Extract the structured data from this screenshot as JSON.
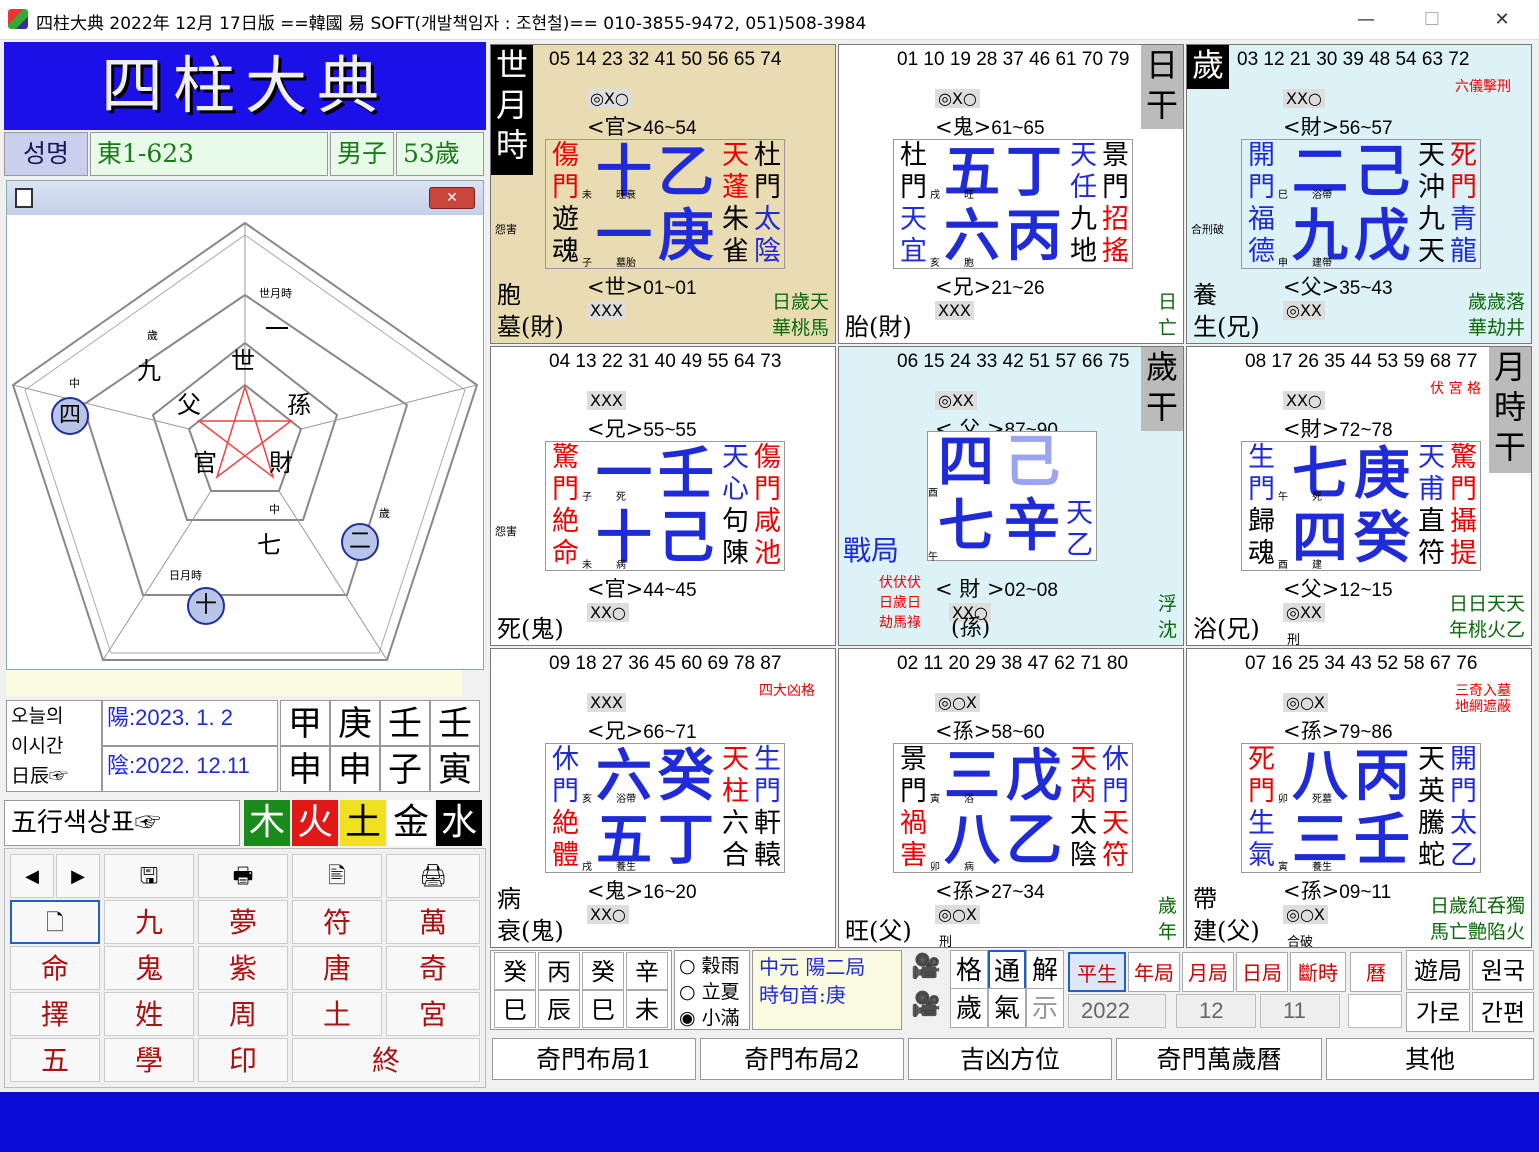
{
  "titlebar": {
    "title": "四柱大典 2022年 12月 17日版 ==韓國 易 SOFT(개발책임자 : 조현철)== 010-3855-9472, 051)508-3984",
    "min": "—",
    "max": "☐",
    "close": "✕"
  },
  "logo": "四柱大典",
  "name_row": {
    "label": "성명",
    "value": "東1-623",
    "gender": "男子",
    "age": "53歲"
  },
  "pentagon": {
    "close": "✕",
    "inner": [
      "世",
      "孫",
      "財",
      "官",
      "父"
    ],
    "outer": [
      {
        "sub": "世月時",
        "main": "一"
      },
      {
        "sub": "歲",
        "main": "九"
      },
      {
        "sub": "中",
        "main": "四"
      },
      {
        "sub": "中",
        "main": "七"
      },
      {
        "sub": "歲",
        "main": "二"
      },
      {
        "sub": "日月時",
        "main": "十"
      }
    ]
  },
  "today": {
    "label1": "오늘의",
    "label2": "이시간",
    "label3": "日辰☞",
    "solar": "陽:2023.  1. 2",
    "lunar": "陰:2022.  12.11",
    "stems": [
      "甲",
      "庚",
      "壬",
      "壬"
    ],
    "branches": [
      "申",
      "申",
      "子",
      "寅"
    ]
  },
  "elements": {
    "label": "五行색상표☞",
    "items": [
      "木",
      "火",
      "土",
      "金",
      "水"
    ],
    "colors": [
      "#1a8a1a",
      "#e01818",
      "#f0e020",
      "#ffffff",
      "#000000"
    ]
  },
  "toolbar": {
    "row1": [
      "◀",
      "▶",
      "🖫",
      "🖶",
      "🖹",
      "🖨"
    ],
    "row2": [
      "🗋",
      "九",
      "夢",
      "符",
      "萬"
    ],
    "row3": [
      "命",
      "鬼",
      "紫",
      "唐",
      "奇"
    ],
    "row4": [
      "擇",
      "姓",
      "周",
      "土",
      "宮"
    ],
    "row5": [
      "五",
      "學",
      "印",
      "終"
    ]
  },
  "cells": [
    {
      "nums": "05 14 23 32 41 50 56 65 74",
      "side": [
        "世",
        "月",
        "時"
      ],
      "marks": "◎X○",
      "rel_top": "<官>",
      "rel_top_r": "46~54",
      "left_note": "怨害",
      "big1": "十",
      "big2": "乙",
      "big3": "一",
      "big4": "庚",
      "l1": "傷門",
      "l1c": "red",
      "l2": "遊魂",
      "l2c": "black",
      "sm1": "未",
      "sm2": "旺衰",
      "sm3": "子",
      "sm4": "墓胎",
      "r1": "天蓬",
      "r1c": "red",
      "r2": "杜門",
      "r2c": "black",
      "r3": "朱雀",
      "r3c": "black",
      "r4": "太陰",
      "r4c": "blu",
      "rel_bot": "<世>",
      "rel_bot_r": "01~01",
      "marks2": "XXX",
      "bl1": "胞",
      "bl2": "墓(財)",
      "br": "日歲天\n華桃馬"
    },
    {
      "nums": "01 10 19 28 37 46 61 70 79",
      "side": [
        "日",
        "干"
      ],
      "marks": "◎X○",
      "rel_top": "<鬼>",
      "rel_top_r": "61~65",
      "big1": "五",
      "big2": "丁",
      "big3": "六",
      "big4": "丙",
      "l1": "杜門",
      "l1c": "black",
      "l2": "天宜",
      "l2c": "blu",
      "sm1": "戌",
      "sm2": "旺",
      "sm3": "亥",
      "sm4": "胞",
      "r1": "天任",
      "r1c": "blu",
      "r2": "景門",
      "r2c": "black",
      "r3": "九地",
      "r3c": "black",
      "r4": "招搖",
      "r4c": "red",
      "rel_bot": "<兄>",
      "rel_bot_r": "21~26",
      "marks2": "XXX",
      "bl1": "",
      "bl2": "胎(財)",
      "br": "日\n亡"
    },
    {
      "nums": "03 12 21 30 39 48 54 63 72",
      "side": [
        "歲"
      ],
      "marks": "XX○",
      "rel_top": "<財>",
      "rel_top_r": "56~57",
      "top_note": "六儀擊刑",
      "left_note": "合刑破",
      "big1": "二",
      "big2": "己",
      "big3": "九",
      "big4": "戊",
      "l1": "開門",
      "l1c": "blu",
      "l2": "福德",
      "l2c": "blu",
      "sm1": "巳",
      "sm2": "浴帶",
      "sm3": "申",
      "sm4": "建帶",
      "r1": "天沖",
      "r1c": "black",
      "r2": "死門",
      "r2c": "red",
      "r3": "九天",
      "r3c": "black",
      "r4": "青龍",
      "r4c": "blu",
      "rel_bot": "<父>",
      "rel_bot_r": "35~43",
      "marks2": "◎XX",
      "bl1": "養",
      "bl2": "生(兄)",
      "br": "歲歲落\n華劫井"
    },
    {
      "nums": "04 13 22 31 40 49 55 64 73",
      "side": [],
      "marks": "XXX",
      "rel_top": "<兄>",
      "rel_top_r": "55~55",
      "left_note": "怨害",
      "big1": "一",
      "big2": "壬",
      "big3": "十",
      "big4": "己",
      "l1": "驚門",
      "l1c": "red",
      "l2": "絶命",
      "l2c": "red",
      "sm1": "子",
      "sm2": "死",
      "sm3": "未",
      "sm4": "病",
      "r1": "天心",
      "r1c": "blu",
      "r2": "傷門",
      "r2c": "red",
      "r3": "句陳",
      "r3c": "black",
      "r4": "咸池",
      "r4c": "red",
      "rel_bot": "<官>",
      "rel_bot_r": "44~45",
      "marks2": "XX○",
      "bl1": "",
      "bl2": "死(鬼)",
      "br": ""
    },
    {
      "nums": "06 15 24 33 42 51 57 66 75",
      "side": [
        "歲",
        "干"
      ],
      "marks": "◎XX",
      "rel_top": "< 父 >",
      "rel_top_r": "87~90",
      "big1": "四",
      "big2": "己",
      "big3": "七",
      "big4": "辛",
      "center": true,
      "l1": "戰局",
      "r1": "天乙",
      "sm1": "酉",
      "sm3": "午",
      "rel_bot": "< 財 >",
      "rel_bot_r": "02~08",
      "marks2": "XX○",
      "note_red": "伏伏伏\n日歲日\n劫馬祿",
      "bl2": "(孫)",
      "br": "浮\n沈"
    },
    {
      "nums": "08 17 26 35 44 53 59 68 77",
      "side": [
        "月",
        "時",
        "干"
      ],
      "marks": "XX○",
      "rel_top": "<財>",
      "rel_top_r": "72~78",
      "top_note": "伏 宮 格",
      "big1": "七",
      "big2": "庚",
      "big3": "四",
      "big4": "癸",
      "l1": "生門",
      "l1c": "blu",
      "l2": "歸魂",
      "l2c": "black",
      "sm1": "午",
      "sm2": "死",
      "sm3": "酉",
      "sm4": "建",
      "r1": "天甫",
      "r1c": "blu",
      "r2": "驚門",
      "r2c": "red",
      "r3": "直符",
      "r3c": "black",
      "r4": "攝提",
      "r4c": "red",
      "rel_bot": "<父>",
      "rel_bot_r": "12~15",
      "marks2": "◎XX",
      "bl1": "",
      "bl2": "浴(兄)",
      "bl_sm": "刑",
      "br": "日日天天\n年桃火乙"
    },
    {
      "nums": "09 18 27 36 45 60 69 78 87",
      "side": [],
      "marks": "XXX",
      "rel_top": "<兄>",
      "rel_top_r": "66~71",
      "top_note": "四大凶格",
      "big1": "六",
      "big2": "癸",
      "big3": "五",
      "big4": "丁",
      "l1": "休門",
      "l1c": "blu",
      "l2": "絶體",
      "l2c": "red",
      "sm1": "亥",
      "sm2": "浴帶",
      "sm3": "戌",
      "sm4": "養生",
      "r1": "天柱",
      "r1c": "red",
      "r2": "生門",
      "r2c": "blu",
      "r3": "六合",
      "r3c": "black",
      "r4": "軒轅",
      "r4c": "black",
      "rel_bot": "<鬼>",
      "rel_bot_r": "16~20",
      "marks2": "XX○",
      "bl1": "病",
      "bl2": "衰(鬼)",
      "br": ""
    },
    {
      "nums": "02 11 20 29 38 47 62 71 80",
      "side": [],
      "marks": "◎○X",
      "rel_top": "<孫>",
      "rel_top_r": "58~60",
      "big1": "三",
      "big2": "戊",
      "big3": "八",
      "big4": "乙",
      "l1": "景門",
      "l1c": "black",
      "l2": "禍害",
      "l2c": "red",
      "sm1": "寅",
      "sm2": "浴",
      "sm3": "卯",
      "sm4": "病",
      "r1": "天芮",
      "r1c": "red",
      "r2": "休門",
      "r2c": "blu",
      "r3": "太陰",
      "r3c": "black",
      "r4": "天符",
      "r4c": "red",
      "rel_bot": "<孫>",
      "rel_bot_r": "27~34",
      "marks2": "◎○X",
      "bl1": "",
      "bl2": "旺(父)",
      "bl_sm": "刑",
      "br": "歲\n年"
    },
    {
      "nums": "07 16 25 34 43 52 58 67 76",
      "side": [],
      "marks": "◎○X",
      "rel_top": "<孫>",
      "rel_top_r": "79~86",
      "top_note": "三奇入墓\n地網遮蔽",
      "big1": "八",
      "big2": "丙",
      "big3": "三",
      "big4": "壬",
      "l1": "死門",
      "l1c": "red",
      "l2": "生氣",
      "l2c": "blu",
      "sm1": "卯",
      "sm2": "死墓",
      "sm3": "寅",
      "sm4": "養生",
      "r1": "天英",
      "r1c": "black",
      "r2": "開門",
      "r2c": "blu",
      "r3": "騰蛇",
      "r3c": "black",
      "r4": "太乙",
      "r4c": "blu",
      "rel_bot": "<孫>",
      "rel_bot_r": "09~11",
      "marks2": "◎○X",
      "bl1": "帶",
      "bl2": "建(父)",
      "bl_sm": "合破",
      "br": "日歲紅呑獨\n馬亡艶陷火"
    }
  ],
  "bottom": {
    "ganzhi_top": [
      "癸",
      "丙",
      "癸",
      "辛"
    ],
    "ganzhi_bot": [
      "巳",
      "辰",
      "巳",
      "未"
    ],
    "radios": [
      "穀雨",
      "立夏",
      "小滿"
    ],
    "info1": "中元  陽二局",
    "info2": "時旬首:庚",
    "g1": [
      "格",
      "通",
      "解"
    ],
    "g2": [
      "歲",
      "氣",
      "示"
    ],
    "modes": [
      "平生",
      "年局",
      "月局",
      "日局",
      "斷時",
      "曆"
    ],
    "year": "2022",
    "month": "12",
    "day": "11",
    "right1": [
      "遊局",
      "원국"
    ],
    "right2": [
      "가로",
      "간편"
    ],
    "tabs": [
      "奇門布局1",
      "奇門布局2",
      "吉凶方位",
      "奇門萬歲曆",
      "其他"
    ]
  }
}
